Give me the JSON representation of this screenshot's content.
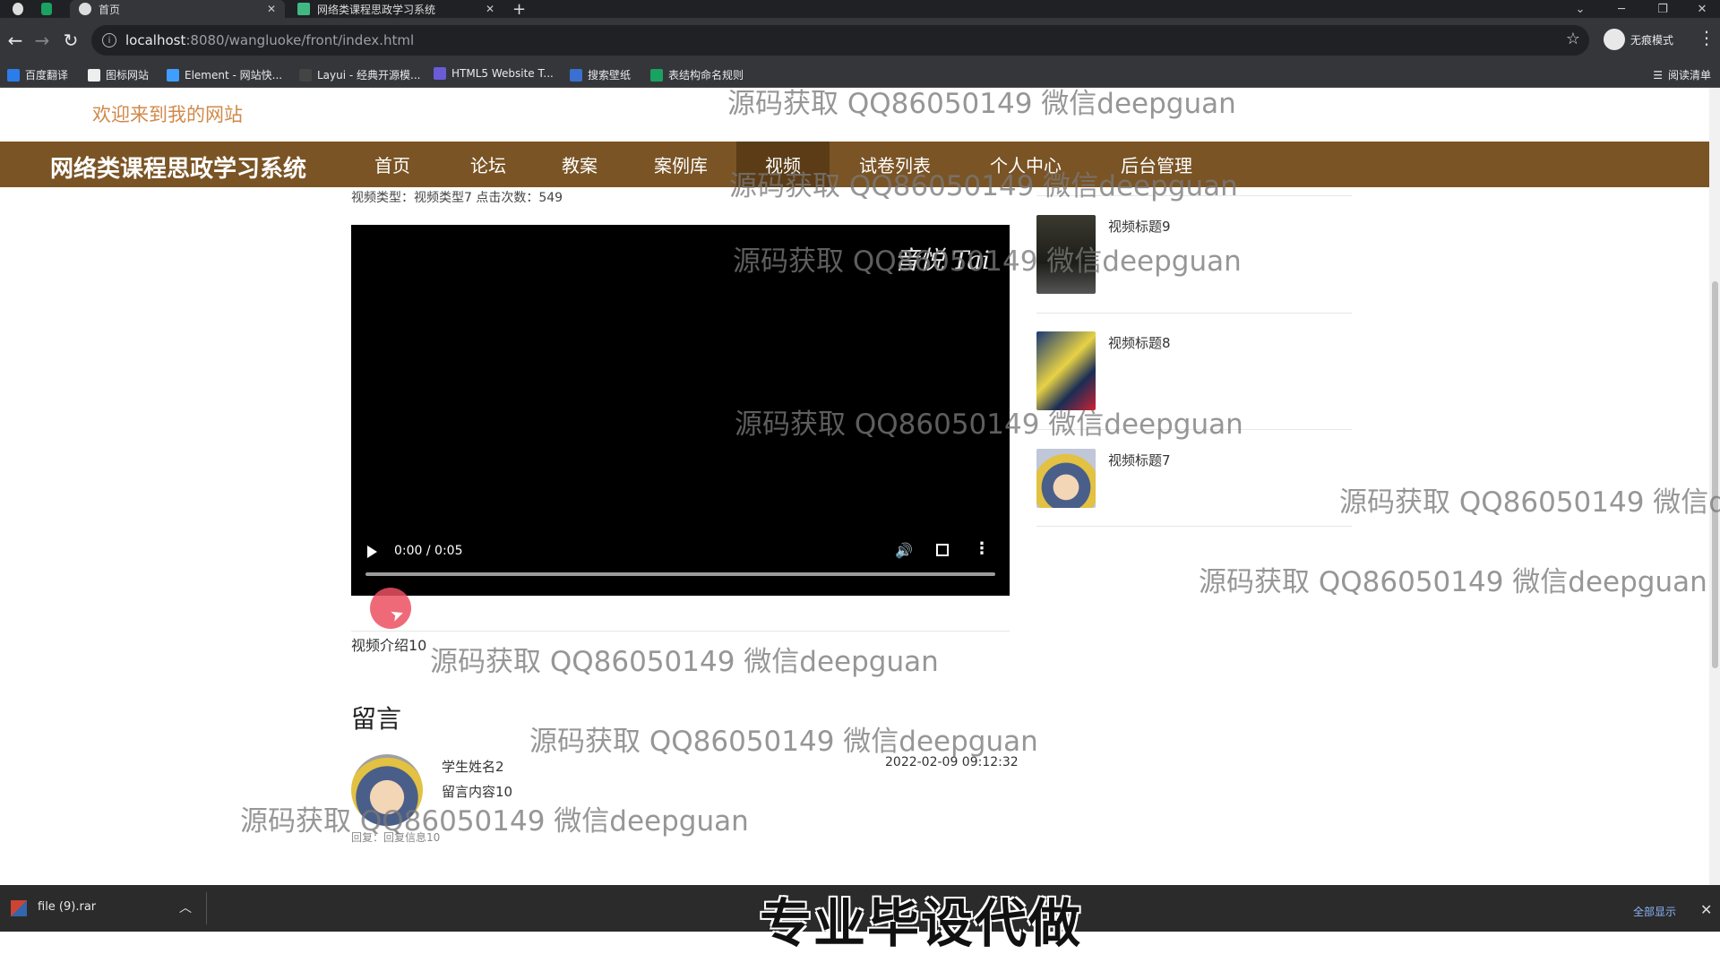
{
  "browser": {
    "tabs": [
      {
        "title": ""
      },
      {
        "title": ""
      },
      {
        "title": "首页"
      },
      {
        "title": "网络类课程思政学习系统"
      }
    ],
    "new_tab_symbol": "+",
    "close_symbol": "✕",
    "url_host": "localhost",
    "url_rest": ":8080/wangluoke/front/index.html",
    "incognito_label": "无痕模式",
    "bookmarks": [
      "百度翻译",
      "图标网站",
      "Element - 网站快...",
      "Layui - 经典开源模...",
      "HTML5 Website T...",
      "搜索壁纸",
      "表结构命名规则"
    ],
    "reading_list": "阅读清单"
  },
  "site": {
    "welcome": "欢迎来到我的网站",
    "title": "网络类课程思政学习系统",
    "nav": [
      "首页",
      "论坛",
      "教案",
      "案例库",
      "视频",
      "试卷列表",
      "个人中心",
      "后台管理"
    ],
    "nav_active_index": 4
  },
  "video": {
    "meta_line": "视频类型：视频类型7  点击次数：549",
    "logo_text": "音悦 Tai",
    "time": "0:00 / 0:05",
    "progress": 0,
    "intro": "视频介绍10"
  },
  "comments": {
    "heading": "留言",
    "items": [
      {
        "author": "学生姓名2",
        "content": "留言内容10",
        "time": "2022-02-09 09:12:32",
        "reply": "回复：回复信息10"
      }
    ]
  },
  "related": [
    {
      "title": "视频标题9"
    },
    {
      "title": "视频标题8"
    },
    {
      "title": "视频标题7"
    }
  ],
  "watermark": "源码获取 QQ86050149 微信deepguan",
  "download": {
    "file": "file (9).rar",
    "show_all": "全部显示"
  },
  "overlay_caption": "专业毕设代做",
  "colors": {
    "nav_bg": "#7a5425",
    "nav_active": "#5b3c16",
    "welcome": "#d08a4a"
  }
}
